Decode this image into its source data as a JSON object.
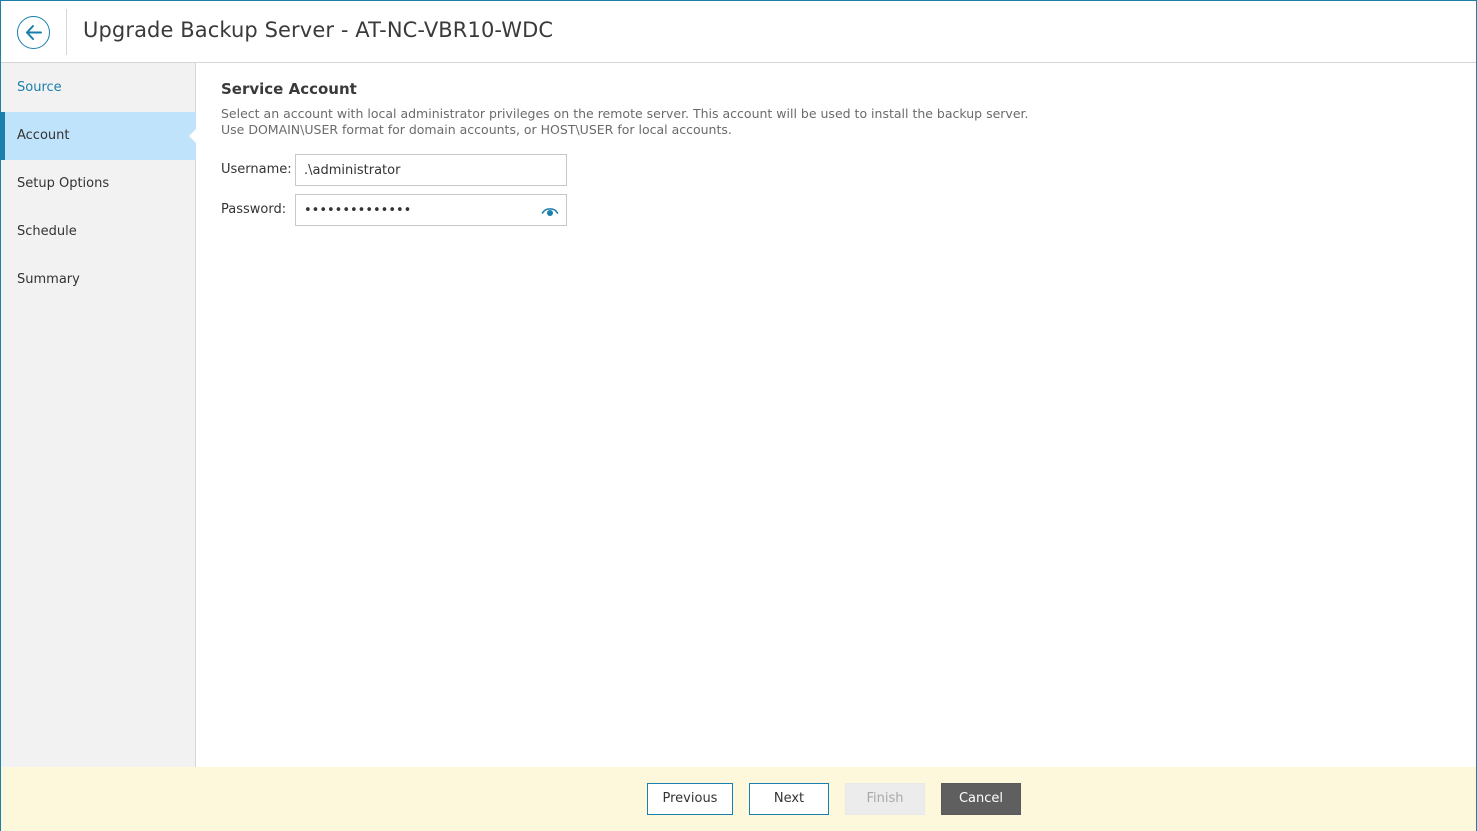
{
  "header": {
    "back_icon": "arrow-left-icon",
    "title": "Upgrade Backup Server - AT-NC-VBR10-WDC"
  },
  "sidebar": {
    "items": [
      {
        "label": "Source",
        "state": "visited"
      },
      {
        "label": "Account",
        "state": "active"
      },
      {
        "label": "Setup Options",
        "state": "default"
      },
      {
        "label": "Schedule",
        "state": "default"
      },
      {
        "label": "Summary",
        "state": "default"
      }
    ]
  },
  "main": {
    "section_title": "Service Account",
    "description": "Select an account with local administrator privileges on the remote server. This account will be used to install the backup server. Use DOMAIN\\USER format for domain accounts, or HOST\\USER for local accounts.",
    "username_label": "Username:",
    "username_value": ".\\administrator",
    "password_label": "Password:",
    "password_value": "••••••••••••••",
    "password_toggle_icon": "eye-icon"
  },
  "footer": {
    "previous_label": "Previous",
    "next_label": "Next",
    "finish_label": "Finish",
    "cancel_label": "Cancel"
  },
  "colors": {
    "accent": "#1a7fac",
    "active_nav_bg": "#bfe3fb",
    "footer_bg": "#fdf8dc",
    "cancel_bg": "#5f5f5f"
  }
}
